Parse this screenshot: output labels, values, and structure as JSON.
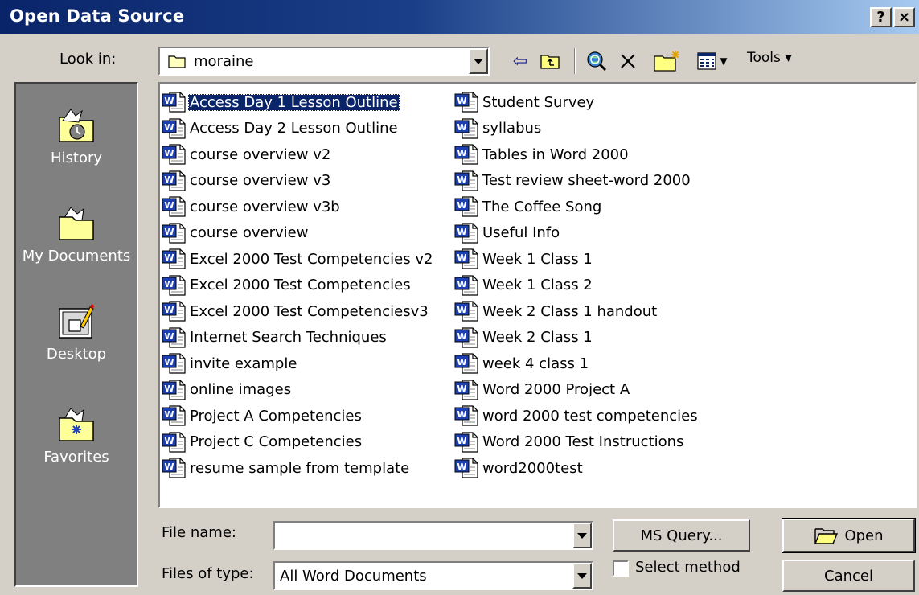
{
  "window": {
    "title": "Open Data Source",
    "help_label": "?",
    "close_label": "×"
  },
  "lookin": {
    "label": "Look in:",
    "value": "moraine"
  },
  "toolbar": {
    "back_glyph": "⇦",
    "tools_label": "Tools ▾"
  },
  "places": [
    {
      "label": "History"
    },
    {
      "label": "My Documents"
    },
    {
      "label": "Desktop"
    },
    {
      "label": "Favorites"
    }
  ],
  "files": {
    "column1": [
      "Access Day 1 Lesson Outline",
      "Access Day 2 Lesson Outline",
      "course overview v2",
      "course overview v3",
      "course overview v3b",
      "course overview",
      "Excel 2000 Test Competencies v2",
      "Excel 2000 Test Competencies",
      "Excel 2000 Test Competenciesv3",
      "Internet Search Techniques",
      "invite example",
      "online images",
      "Project A Competencies",
      "Project C Competencies",
      "resume sample from template"
    ],
    "column2": [
      "Student Survey",
      "syllabus",
      "Tables in Word 2000",
      "Test review sheet-word 2000",
      "The Coffee Song",
      "Useful Info",
      "Week 1 Class 1",
      "Week 1 Class 2",
      "Week 2 Class 1 handout",
      "Week 2 Class 1",
      "week 4 class 1",
      "Word 2000 Project A",
      "word 2000 test competencies",
      "Word 2000 Test Instructions",
      "word2000test"
    ]
  },
  "filename": {
    "label": "File name:",
    "value": ""
  },
  "filetype": {
    "label": "Files of type:",
    "value": "All Word Documents"
  },
  "buttons": {
    "msquery": "MS Query...",
    "open": "Open",
    "cancel": "Cancel"
  },
  "select_method": {
    "label": "Select method",
    "checked": false
  }
}
